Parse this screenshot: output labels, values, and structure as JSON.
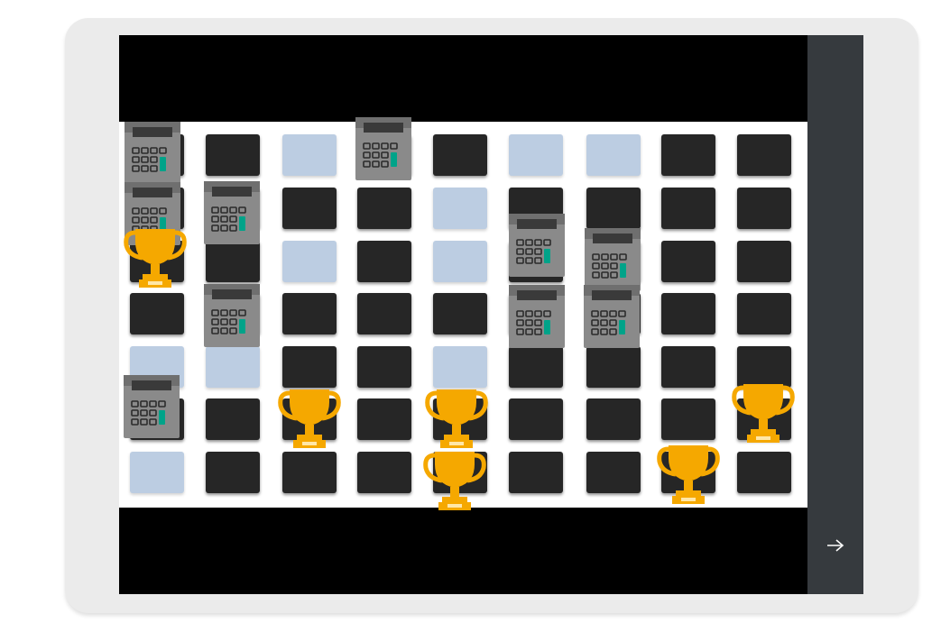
{
  "game": {
    "grid": {
      "rows": 7,
      "cols": 9,
      "tiles": [
        [
          "dark",
          "dark",
          "light",
          "dark",
          "dark",
          "light",
          "light",
          "dark",
          "dark"
        ],
        [
          "dark",
          "dark",
          "dark",
          "dark",
          "light",
          "dark",
          "dark",
          "dark",
          "dark"
        ],
        [
          "dark",
          "dark",
          "light",
          "dark",
          "light",
          "dark",
          "dark",
          "dark",
          "dark"
        ],
        [
          "dark",
          "dark",
          "dark",
          "dark",
          "dark",
          "dark",
          "dark",
          "dark",
          "dark"
        ],
        [
          "light",
          "light",
          "dark",
          "dark",
          "light",
          "dark",
          "dark",
          "dark",
          "dark"
        ],
        [
          "dark",
          "dark",
          "dark",
          "dark",
          "dark",
          "dark",
          "dark",
          "dark",
          "dark"
        ],
        [
          "light",
          "dark",
          "dark",
          "dark",
          "dark",
          "dark",
          "dark",
          "dark",
          "dark"
        ]
      ]
    },
    "pieces": {
      "calculator_count": 9,
      "trophy_count": 6
    },
    "colors": {
      "dark_tile": "#262626",
      "light_tile": "#bccde2",
      "trophy": "#f5a800",
      "calculator_body": "#8a8a8a",
      "calculator_screen": "#3a3a3a",
      "calculator_key_accent": "#00a389",
      "sidebar": "#363a3e"
    },
    "icons": {
      "calculator": "calculator-icon",
      "trophy": "trophy-icon",
      "next": "arrow-right-icon"
    }
  },
  "sidebar": {
    "next_arrow": "→"
  }
}
